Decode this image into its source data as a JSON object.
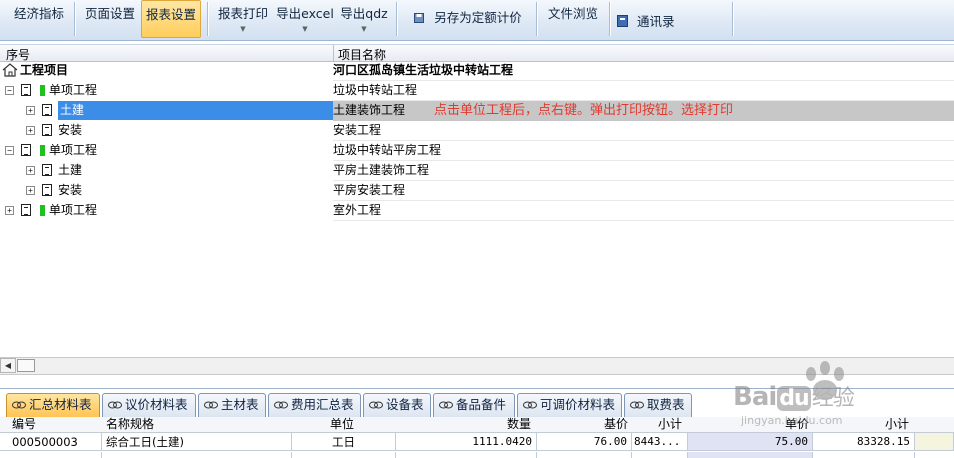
{
  "ribbon": {
    "economic_index": "经济指标",
    "page_setup": "页面设置",
    "report_setup": "报表设置",
    "report_print": "报表打印",
    "export_excel": "导出excel",
    "export_qdz": "导出qdz",
    "save_as_quota": "另存为定额计价",
    "file_browse": "文件浏览",
    "contacts": "通讯录"
  },
  "columns": {
    "seq": "序号",
    "project_name": "项目名称"
  },
  "tree": [
    {
      "label": "工程项目",
      "name": "河口区孤岛镇生活垃圾中转站工程",
      "level": 0,
      "bold": true
    },
    {
      "label": "单项工程",
      "name": "垃圾中转站工程",
      "level": 1,
      "expander": "−"
    },
    {
      "label": "土建",
      "name": "土建装饰工程",
      "level": 2,
      "expander": "+",
      "selected": true
    },
    {
      "label": "安装",
      "name": "安装工程",
      "level": 2,
      "expander": "+"
    },
    {
      "label": "单项工程",
      "name": "垃圾中转站平房工程",
      "level": 1,
      "expander": "−"
    },
    {
      "label": "土建",
      "name": "平房土建装饰工程",
      "level": 2,
      "expander": "+"
    },
    {
      "label": "安装",
      "name": "平房安装工程",
      "level": 2,
      "expander": "+"
    },
    {
      "label": "单项工程",
      "name": "室外工程",
      "level": 1,
      "expander": "+"
    }
  ],
  "annotation": "点击单位工程后，点右键。弹出打印按钮。选择打印",
  "tabs": [
    "汇总材料表",
    "议价材料表",
    "主材表",
    "费用汇总表",
    "设备表",
    "备品备件",
    "可调价材料表",
    "取费表"
  ],
  "bottom_table": {
    "headers": {
      "code": "编号",
      "spec": "名称规格",
      "unit": "单位",
      "qty": "数量",
      "base_price": "基价",
      "subtotal1": "小计",
      "unit_price": "单价",
      "subtotal2": "小计"
    },
    "rows": [
      {
        "code": "000500003",
        "spec": "综合工日(土建)",
        "unit": "工日",
        "qty": "1111.0420",
        "base_price": "76.00",
        "subtotal1": "8443...",
        "unit_price": "75.00",
        "subtotal2": "83328.15"
      }
    ]
  },
  "watermark": {
    "brand": "Bai",
    "brand2": "du",
    "text": "经验",
    "url": "jingyan.baidu.com"
  },
  "colors": {
    "accent": "#ffcd5a",
    "selection": "#3b8de8",
    "annotation": "#e03a2f",
    "node_green": "#20c020"
  }
}
